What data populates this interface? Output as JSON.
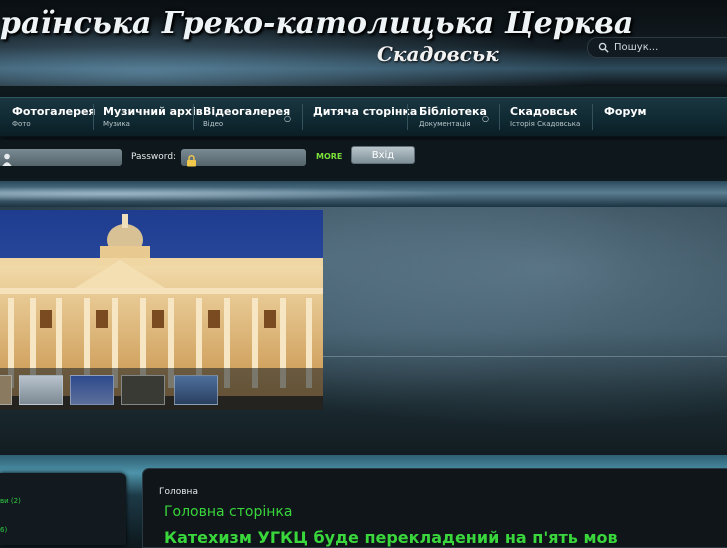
{
  "header": {
    "title": "раїнська Греко-католицька Церква",
    "subtitle": "Скадовськ",
    "search_placeholder": "Пошук..."
  },
  "nav": {
    "items": [
      {
        "label": "Фотогалерея",
        "sub": "Фото"
      },
      {
        "label": "Музичний архів",
        "sub": "Музика"
      },
      {
        "label": "Відеогалерея",
        "sub": "Відео"
      },
      {
        "label": "Дитяча сторінка",
        "sub": ""
      },
      {
        "label": "Бібліотека",
        "sub": "Документація"
      },
      {
        "label": "Скадовськ",
        "sub": "Історія Скадовська"
      },
      {
        "label": "Форум",
        "sub": ""
      }
    ]
  },
  "login": {
    "password_label": "Password:",
    "more_label": "MORE",
    "submit_label": "Вхід"
  },
  "sidebar": {
    "links": [
      "ви (2)",
      "6)"
    ]
  },
  "content": {
    "breadcrumb": "Головна",
    "heading": "Головна сторінка",
    "article_title": "Катехизм УГКЦ буде перекладений на п'ять мов"
  }
}
